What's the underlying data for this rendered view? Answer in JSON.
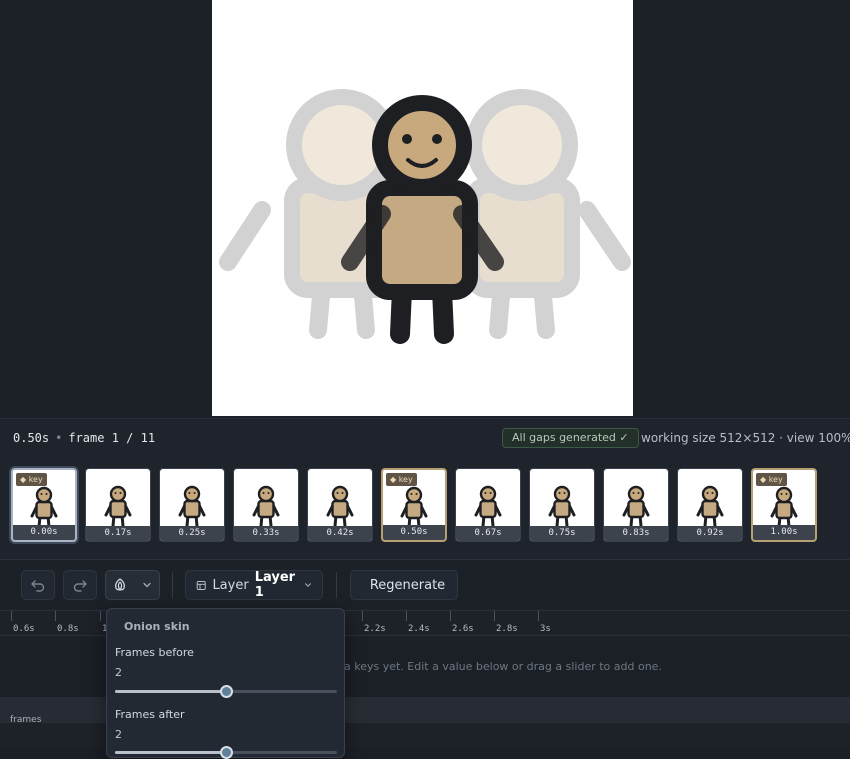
{
  "canvas_area": {
    "character_icon": "smiling-figure-illustration",
    "onion_skin_ghosts": 2
  },
  "info_bar": {
    "time": "0.50s",
    "separator": "•",
    "frame_label": "frame 1 / 11",
    "gaps_badge": "All gaps generated ✓",
    "working_size": "working size 512×512 · view 100%"
  },
  "filmstrip": {
    "frames": [
      {
        "time": "0.00s",
        "key": true,
        "selected": true
      },
      {
        "time": "0.17s",
        "key": false,
        "selected": false
      },
      {
        "time": "0.25s",
        "key": false,
        "selected": false
      },
      {
        "time": "0.33s",
        "key": false,
        "selected": false
      },
      {
        "time": "0.42s",
        "key": false,
        "selected": false
      },
      {
        "time": "0.50s",
        "key": true,
        "selected": false
      },
      {
        "time": "0.67s",
        "key": false,
        "selected": false
      },
      {
        "time": "0.75s",
        "key": false,
        "selected": false
      },
      {
        "time": "0.83s",
        "key": false,
        "selected": false
      },
      {
        "time": "0.92s",
        "key": false,
        "selected": false
      },
      {
        "time": "1.00s",
        "key": true,
        "selected": false
      }
    ],
    "key_tag": "◆ key"
  },
  "toolbar": {
    "undo_icon": "undo-icon",
    "redo_icon": "redo-icon",
    "onion_icon": "onion-icon",
    "layer_prefix": "Layer",
    "layer_name": "Layer 1",
    "regenerate_label": "Regenerate"
  },
  "ruler": {
    "labels": [
      "0.6s",
      "0.8s",
      "1",
      "2.2s",
      "2.4s",
      "2.6s",
      "2.8s",
      "3s"
    ]
  },
  "timeline": {
    "empty_message": "a keys yet. Edit a value below or drag a slider to add one.",
    "track_label": "frames"
  },
  "onion_popover": {
    "title": "Onion skin",
    "frames_before_label": "Frames before",
    "frames_before_value": "2",
    "frames_before_fraction": 0.5,
    "frames_after_label": "Frames after",
    "frames_after_value": "2",
    "frames_after_fraction": 0.5
  },
  "colors": {
    "accent": "#5f7f9b",
    "key_border": "#b69f72",
    "badge_green": "#3f5a44",
    "skin": "#c8a97e",
    "body": "#c4a982",
    "outline": "#1e1f22"
  }
}
